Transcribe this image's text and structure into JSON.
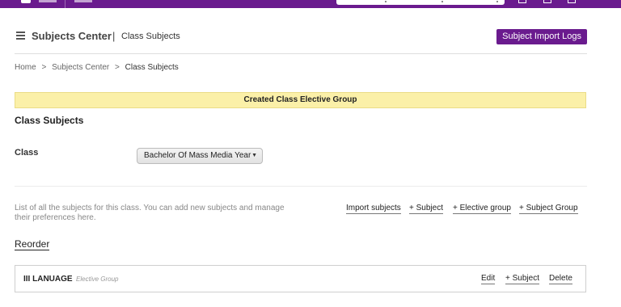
{
  "header": {
    "title": "Subjects Center",
    "divider": "|",
    "current": "Class Subjects",
    "import_logs_button": "Subject Import Logs"
  },
  "breadcrumb": {
    "items": [
      "Home",
      ">",
      "Subjects Center",
      ">",
      "Class Subjects"
    ]
  },
  "banner": {
    "message": "Created Class Elective Group"
  },
  "section": {
    "title": "Class Subjects"
  },
  "class_field": {
    "label": "Class",
    "selected": "Bachelor Of Mass Media Year",
    "arrow": "▼"
  },
  "actions": {
    "description": "List of all the subjects for this class. You can add new subjects and manage their preferences here.",
    "import_subjects": "Import subjects",
    "add_subject": "+ Subject",
    "add_elective_group": "+ Elective group",
    "add_subject_group": "+ Subject Group"
  },
  "reorder": {
    "label": "Reorder"
  },
  "groups": [
    {
      "name": "III LANUAGE",
      "type": "Elective Group",
      "edit": "Edit",
      "add_subject": "+ Subject",
      "delete": "Delete"
    }
  ],
  "colors": {
    "brand": "#6a1b8e",
    "banner_bg": "#fbf0a8"
  }
}
